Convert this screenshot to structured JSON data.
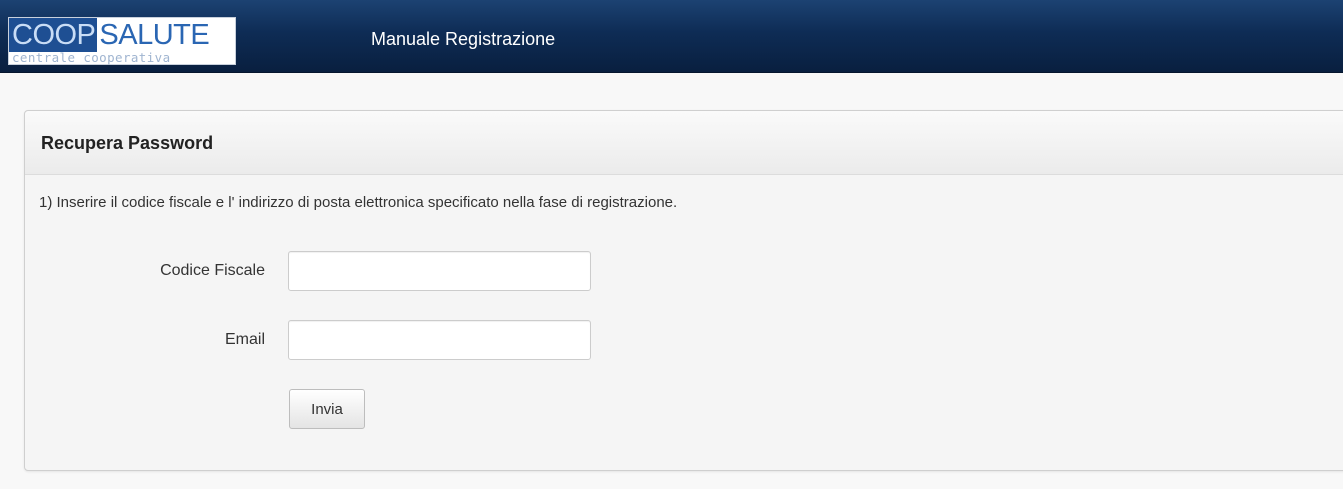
{
  "header": {
    "logo": {
      "brand_part1": "COOP",
      "brand_part2": "SALUTE",
      "tagline": "centrale cooperativa"
    },
    "nav_link": "Manuale Registrazione"
  },
  "panel": {
    "title": "Recupera Password",
    "instructions": "1) Inserire il codice fiscale e l' indirizzo di posta elettronica specificato nella fase di registrazione.",
    "fields": {
      "codice_fiscale": {
        "label": "Codice Fiscale",
        "value": "",
        "placeholder": ""
      },
      "email": {
        "label": "Email",
        "value": "",
        "placeholder": ""
      }
    },
    "submit_label": "Invia"
  },
  "colors": {
    "navbar": "#0e2c55",
    "logo_coop_bg": "#1e4f93",
    "logo_salute_text": "#2a66b3",
    "panel_bg": "#f5f5f5"
  }
}
